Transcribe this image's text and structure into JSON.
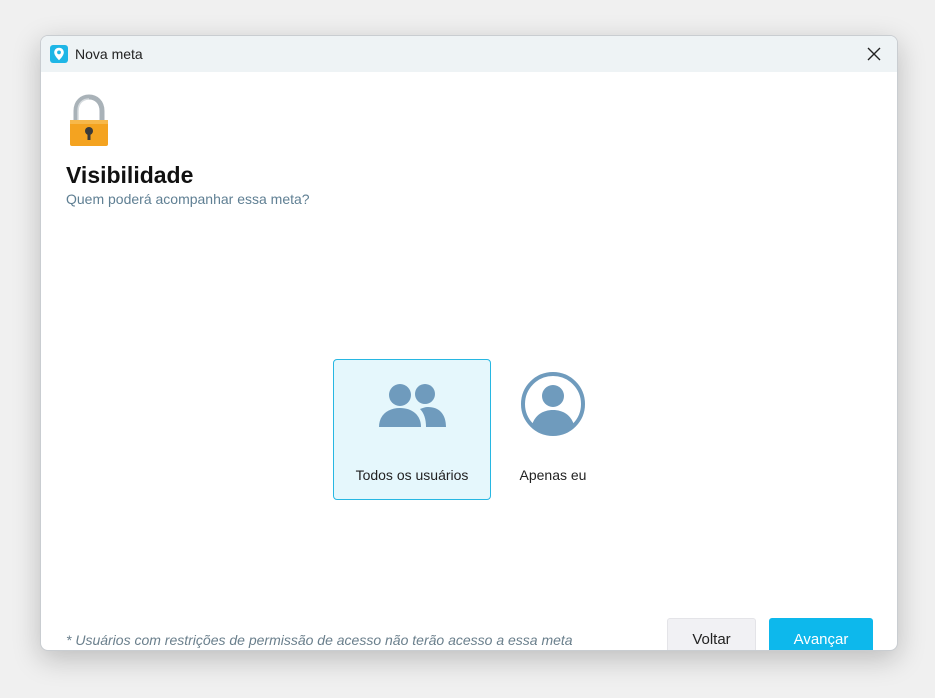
{
  "window": {
    "title": "Nova meta"
  },
  "header": {
    "title": "Visibilidade",
    "subtitle": "Quem poderá acompanhar essa meta?"
  },
  "options": [
    {
      "label": "Todos os usuários",
      "icon": "group-icon",
      "selected": true
    },
    {
      "label": "Apenas eu",
      "icon": "user-circle-icon",
      "selected": false
    }
  ],
  "footer": {
    "note": "* Usuários com restrições de permissão de acesso não terão acesso a essa meta",
    "back_label": "Voltar",
    "next_label": "Avançar"
  },
  "colors": {
    "accent": "#0db8ec",
    "selected_bg": "#e5f7fc",
    "icon": "#6f9bbd"
  }
}
